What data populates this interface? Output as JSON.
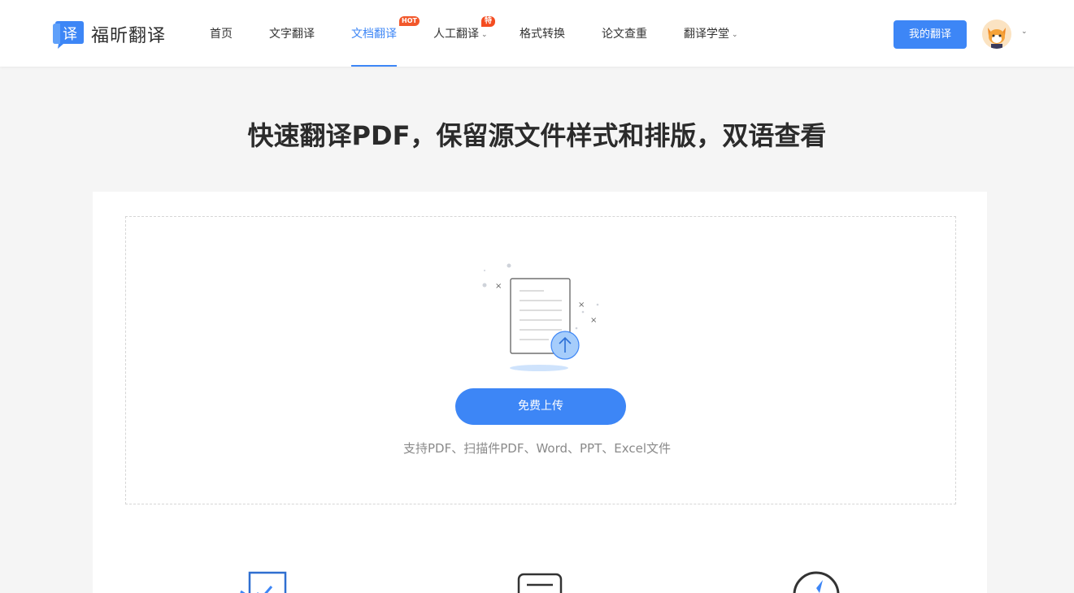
{
  "brand": {
    "name": "福昕翻译",
    "logo_glyph": "译"
  },
  "nav": {
    "items": [
      {
        "label": "首页"
      },
      {
        "label": "文字翻译"
      },
      {
        "label": "文档翻译",
        "badge": "HOT",
        "active": true
      },
      {
        "label": "人工翻译",
        "badge": "特价",
        "dropdown": true
      },
      {
        "label": "格式转换"
      },
      {
        "label": "论文查重"
      },
      {
        "label": "翻译学堂",
        "dropdown": true
      }
    ]
  },
  "header": {
    "my_translation": "我的翻译",
    "avatar_icon": "avatar-image"
  },
  "hero": {
    "title": "快速翻译PDF，保留源文件样式和排版，双语查看"
  },
  "upload": {
    "button_label": "免费上传",
    "support_text": "支持PDF、扫描件PDF、Word、PPT、Excel文件"
  },
  "colors": {
    "accent": "#3d86f6",
    "badge": "#f2582b",
    "background": "#f5f5f5"
  }
}
